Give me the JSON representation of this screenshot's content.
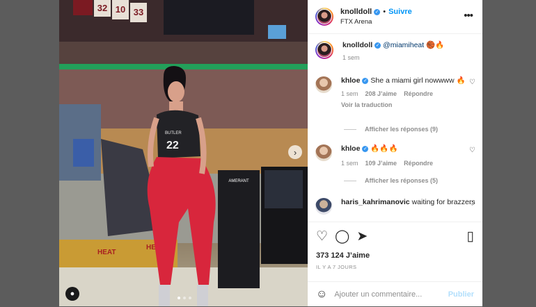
{
  "post": {
    "username": "knolldoll",
    "follow_label": "Suivre",
    "location": "FTX Arena",
    "caption_mention": "@miamiheat",
    "caption_emoji": "🏀🔥",
    "caption_time": "1 sem",
    "likes": "373 124 J’aime",
    "posted_ago": "IL Y A 7 JOURS",
    "comment_placeholder": "Ajouter un commentaire...",
    "publish_label": "Publier",
    "more_label": "•••"
  },
  "comments": [
    {
      "user": "khloe",
      "text": "She a miami girl nowwww 🔥",
      "time": "1 sem",
      "likes": "208 J’aime",
      "reply": "Répondre",
      "translate": "Voir la traduction",
      "replies": "Afficher les réponses (9)"
    },
    {
      "user": "khloe",
      "text": "🔥🔥🔥",
      "time": "1 sem",
      "likes": "109 J’aime",
      "reply": "Répondre",
      "replies": "Afficher les réponses (5)"
    },
    {
      "user": "haris_kahrimanovic",
      "text": "waiting for brazzers"
    }
  ],
  "photo": {
    "jersey_text": "22",
    "jersey_name": "BUTLER",
    "banner_numbers": [
      "32",
      "10",
      "33"
    ],
    "court_text": "HEAT",
    "seat_text": "AMERANT"
  },
  "icons": {
    "like": "heart-icon",
    "comment": "comment-icon",
    "share": "share-icon",
    "save": "bookmark-icon",
    "emoji": "emoji-icon",
    "more": "more-icon",
    "next": "chevron-right-icon",
    "tag": "user-tag-icon",
    "verified": "verified-badge-icon"
  },
  "colors": {
    "accent": "#0095f6",
    "verified": "#3897f0",
    "publish_disabled": "#b2dffc",
    "backdrop": "#5c5c5c"
  }
}
